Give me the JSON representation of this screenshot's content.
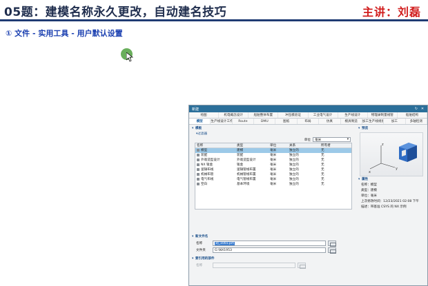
{
  "slide": {
    "title": "05题：建模名称永久更改，自动建名技巧",
    "presenter": "主讲：刘磊",
    "subtitle": "①  文件 - 实用工具 - 用户默认设置"
  },
  "dialog": {
    "title": "新建",
    "tabs_row1": [
      "绘图",
      "机电概念设计",
      "船舶整体布置",
      "冲压模验证",
      "工业电气设计",
      "生产线设计",
      "物理录制量线管",
      "船舶结构"
    ],
    "tabs_row2": [
      "模型",
      "生产线设计工作区",
      "Route",
      "DMU",
      "图纸",
      "布局",
      "仿真",
      "模具制造",
      "加工生产线规划",
      "加工",
      "多轴检测"
    ],
    "active_tab": "模型",
    "template_section": "模板",
    "filter_section": "过滤器",
    "unit_label": "单位",
    "unit_value": "毫米",
    "columns": [
      "名称",
      "类型",
      "单位",
      "关系",
      "所有者"
    ],
    "templates": [
      {
        "name": "模型",
        "type": "建模",
        "unit": "毫米",
        "relation": "独立的",
        "owner": "无",
        "selected": true
      },
      {
        "name": "装配",
        "type": "装配",
        "unit": "毫米",
        "relation": "独立的",
        "owner": "无"
      },
      {
        "name": "外观造型设计",
        "type": "外观造型设计",
        "unit": "毫米",
        "relation": "独立的",
        "owner": "无"
      },
      {
        "name": "NX 钣金",
        "type": "钣金",
        "unit": "毫米",
        "relation": "独立的",
        "owner": "无"
      },
      {
        "name": "逻辑布线",
        "type": "逻辑管线布置",
        "unit": "毫米",
        "relation": "独立的",
        "owner": "无"
      },
      {
        "name": "机械布管",
        "type": "机械管线布置",
        "unit": "毫米",
        "relation": "独立的",
        "owner": "无"
      },
      {
        "name": "电气布线",
        "type": "电气管线布置",
        "unit": "毫米",
        "relation": "独立的",
        "owner": "无"
      },
      {
        "name": "空白",
        "type": "基本环境",
        "unit": "毫米",
        "relation": "独立的",
        "owner": "无"
      }
    ],
    "preview_section": "预览",
    "properties_section": "属性",
    "properties": {
      "name": "名称：模型",
      "type": "类型：建模",
      "unit": "单位：毫米",
      "modified": "上次修改时间：12/23/2021 02:08 下午",
      "description": "描述：带基准 CSYS 的 NX 示例"
    },
    "new_file_section": "新文件名",
    "name_label": "名称",
    "name_value": "刘_1001.prt",
    "folder_label": "文件夹",
    "folder_value": "G:\\NX1953",
    "ref_section": "要引用的部件",
    "ref_name_label": "名称"
  }
}
